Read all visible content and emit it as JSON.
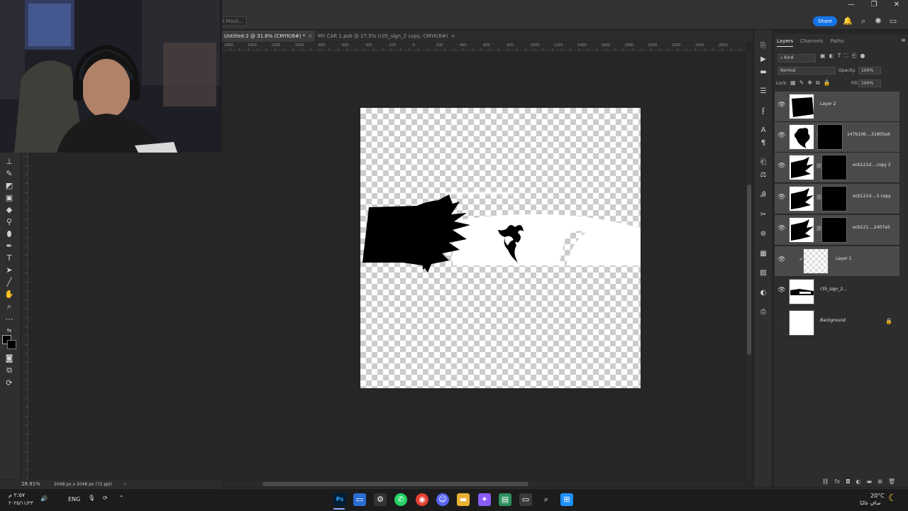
{
  "app": {
    "title": "Adobe Photoshop",
    "window_controls": [
      "—",
      "❐",
      "✕"
    ]
  },
  "options_bar": {
    "select_mask_label": "...d Mask..."
  },
  "top_actions": {
    "share_label": "Share"
  },
  "tabs": [
    {
      "label": "Untitled-2 @ 31.8% (CMYK/8#) *",
      "close": "×",
      "active": true
    },
    {
      "label": "MY CAR 1.psb @ 27.5% (r35_sign_2 copy, CMYK/8#)",
      "close": "×",
      "active": false
    }
  ],
  "ruler_h_labels": [
    "1800",
    "1400",
    "1200",
    "1000",
    "800",
    "600",
    "400",
    "200",
    "0",
    "200",
    "400",
    "600",
    "800",
    "1000",
    "1200",
    "1400",
    "1600",
    "1800",
    "2000",
    "2200",
    "2400",
    "2600"
  ],
  "status_bar": {
    "zoom": "28.91%",
    "doc_size": "2048 px x 2048 px (72 ppi)",
    "arrow": "›"
  },
  "layers_panel": {
    "tabs": [
      "Layers",
      "Channels",
      "Paths"
    ],
    "active_tab": "Layers",
    "filter_kind": "Kind",
    "blend_mode": "Normal",
    "opacity_label": "Opacity:",
    "opacity_value": "100%",
    "lock_label": "Lock:",
    "fill_label": "Fill:",
    "fill_value": "100%",
    "layers": [
      {
        "name": "Layer 2",
        "selected": true,
        "visible": true
      },
      {
        "name": "147b106....51805a6",
        "selected": true,
        "visible": true
      },
      {
        "name": "ecb121d....copy 2",
        "selected": true,
        "visible": true
      },
      {
        "name": "ecb121d....5 copy",
        "selected": true,
        "visible": true
      },
      {
        "name": "ecb121....2407a5",
        "selected": true,
        "visible": true
      },
      {
        "name": "Layer 1",
        "selected": true,
        "visible": true
      },
      {
        "name": "r35_sign_2...",
        "selected": false,
        "visible": true
      },
      {
        "name": "Background",
        "selected": false,
        "visible": false,
        "locked": true
      }
    ]
  },
  "taskbar": {
    "clock_time": "٢:٥٧ م",
    "clock_date": "٢٠٢٥/١١/٢٣",
    "language": "ENG",
    "weather_temp": "20°C",
    "weather_text": "صافٍ غالبًا",
    "ps_label": "Ps"
  },
  "colors": {
    "accent": "#1473e6",
    "panel_bg": "#2d2d2d",
    "workspace_bg": "#262626",
    "selected_layer": "#4a4a4a"
  }
}
